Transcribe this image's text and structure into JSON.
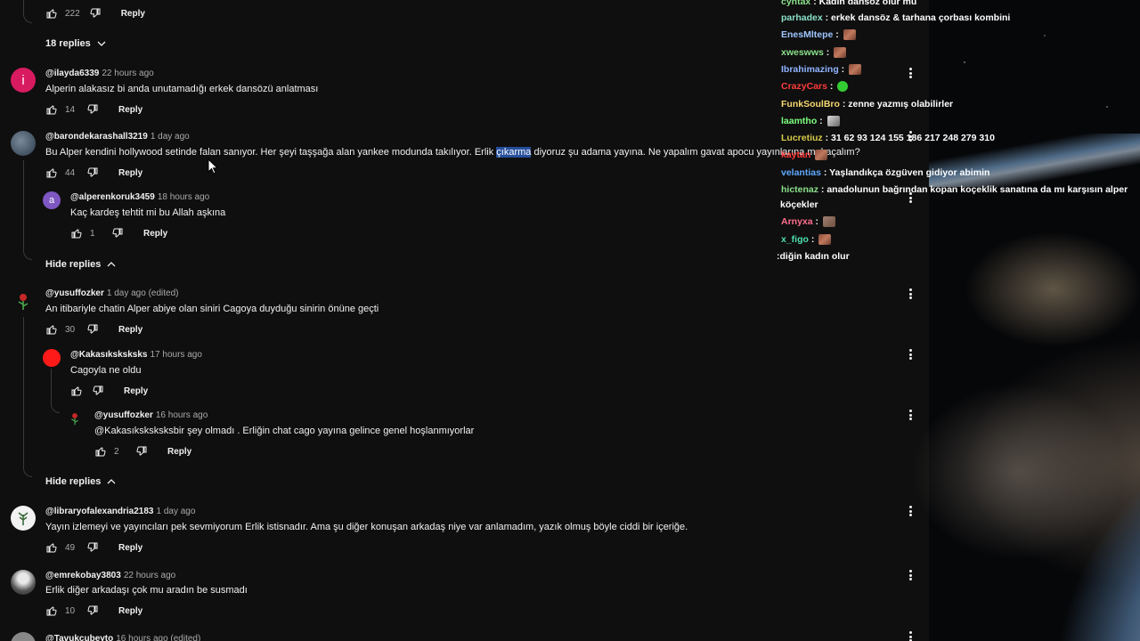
{
  "comments": {
    "c0": {
      "likes": "222",
      "reply": "Reply"
    },
    "toggle_18": "18 replies",
    "c1": {
      "handle": "@ilayda6339",
      "time": "22 hours ago",
      "text": "Alperin alakasız bi anda unutamadığı erkek dansözü anlatması",
      "likes": "14",
      "reply": "Reply",
      "avatar_letter": "i"
    },
    "c2": {
      "handle": "@barondekarashall3219",
      "time": "1 day ago",
      "text_before": "Bu Alper kendini hollywood setinde falan sanıyor. Her şeyi taşşağa alan yankee modunda takılıyor. Erlik ",
      "text_highlight": "çıkarma",
      "text_after": " diyoruz şu adama yayına. Ne yapalım gavat apocu yayınlarına mı kaçalım?",
      "likes": "44",
      "reply": "Reply"
    },
    "r2a": {
      "handle": "@alperenkoruk3459",
      "time": "18 hours ago",
      "text": "Kaç kardeş tehtit mi bu  Allah aşkına",
      "likes": "1",
      "reply": "Reply",
      "avatar_letter": "a"
    },
    "hide1": "Hide replies",
    "c3": {
      "handle": "@yusuffozker",
      "time": "1 day ago (edited)",
      "text": "An itibariyle chatin Alper abiye olan siniri Cagoya duyduğu sinirin önüne geçti",
      "likes": "30",
      "reply": "Reply"
    },
    "r3a": {
      "handle": "@Kakasıksksksks",
      "time": "17 hours ago",
      "text": "Cagoyla ne oldu",
      "reply": "Reply"
    },
    "r3b": {
      "handle": "@yusuffozker",
      "time": "16 hours ago",
      "text": "@Kakasıksksksksbir şey olmadı . Erliğin chat cago yayına gelince genel hoşlanmıyorlar",
      "likes": "2",
      "reply": "Reply"
    },
    "hide2": "Hide replies",
    "c4": {
      "handle": "@libraryofalexandria2183",
      "time": "1 day ago",
      "text": "Yayın izlemeyi ve yayıncıları pek sevmiyorum Erlik istisnadır. Ama şu diğer konuşan arkadaş niye var anlamadım, yazık olmuş böyle ciddi bir içeriğe.",
      "likes": "49",
      "reply": "Reply"
    },
    "c5": {
      "handle": "@emrekobay3803",
      "time": "22 hours ago",
      "text": "Erlik diğer arkadaşı çok mu aradın be susmadı",
      "likes": "10",
      "reply": "Reply"
    },
    "c6": {
      "handle": "@Tavukcubeyto",
      "time": "16 hours ago (edited)"
    }
  },
  "chat": [
    {
      "name": "cyntax",
      "msg": " : Kadın dansöz olur mu",
      "color": "#8be08b"
    },
    {
      "name": "parhadex",
      "msg": " : erkek dansöz & tarhana çorbası kombini",
      "color": "#8be0c8"
    },
    {
      "name": "EnesMltepe",
      "msg": " : ",
      "color": "#9ec6ff",
      "emote": "brown"
    },
    {
      "name": "xweswws",
      "msg": " : ",
      "color": "#8be08b",
      "emote": "brown"
    },
    {
      "name": "Ibrahimazing",
      "msg": " : ",
      "color": "#8fb3ff",
      "emote": "brown"
    },
    {
      "name": "CrazyCars",
      "msg": " : ",
      "color": "#ff3b3b",
      "emote": "green"
    },
    {
      "name": "FunkSoulBro",
      "msg": " : zenne yazmış olabilirler",
      "color": "#f5d76e"
    },
    {
      "name": "laamtho",
      "msg": " : ",
      "color": "#7cff7c",
      "emote": "cat"
    },
    {
      "name": "Lucretiuz",
      "msg": " : 31 62 93 124 155 186 217 248 279 310",
      "color": "#d6c94a"
    },
    {
      "name": "kaytan",
      "msg": " ",
      "color": "#ff3b3b",
      "emote": "brown"
    },
    {
      "name": "velantias",
      "msg": " : Yaşlandıkça özgüven gidiyor abimin",
      "color": "#5fa8ff"
    },
    {
      "name": "hictenaz",
      "msg": " : anadolunun bağrından kopan koçeklik sanatına da mı karşısın alper",
      "color": "#8be08b"
    },
    {
      "name": "",
      "msg": "köçekler",
      "color": "#ffffff"
    },
    {
      "name": "Arnyxa",
      "msg": " : ",
      "color": "#ff6f8e",
      "emote": "face"
    },
    {
      "name": "x_figo",
      "msg": " : ",
      "color": "#4de0b0",
      "emote": "brown"
    },
    {
      "name": "",
      "msg": ":diğin kadın olur",
      "color": "#ffffff"
    }
  ],
  "icons": {
    "like": "thumbs-up-icon",
    "dislike": "thumbs-down-icon",
    "more": "more-vert-icon",
    "chevron_down": "chevron-down-icon",
    "chevron_up": "chevron-up-icon",
    "cursor": "mouse-cursor-icon"
  }
}
